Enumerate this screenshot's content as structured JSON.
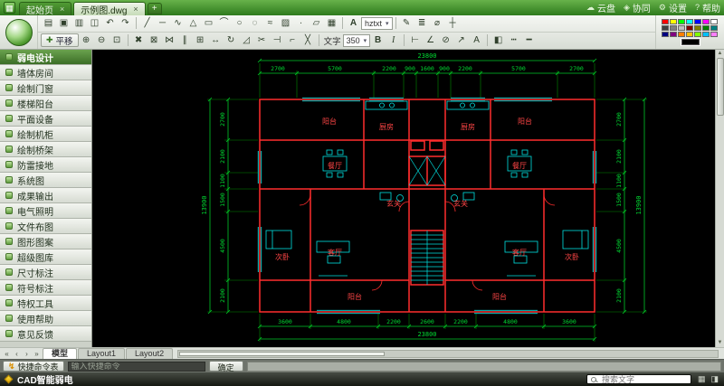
{
  "titlebar": {
    "app_icon_glyph": "▦",
    "close_glyph": "×",
    "new_tab_glyph": "+",
    "tabs": [
      {
        "name": "tab-start-page",
        "label": "起始页"
      },
      {
        "name": "tab-drawing",
        "label": "示例图.dwg"
      }
    ],
    "actions": [
      {
        "name": "cloud-drive-button",
        "icon": "☁",
        "label": "云盘"
      },
      {
        "name": "collaborate-button",
        "icon": "◈",
        "label": "协同"
      },
      {
        "name": "settings-button",
        "icon": "⚙",
        "label": "设置"
      },
      {
        "name": "help-button",
        "icon": "?",
        "label": "帮助"
      }
    ]
  },
  "toolbar": {
    "text_style_icon": "A",
    "text_style": "hztxt",
    "caret": "▾",
    "pan": {
      "label": "平移",
      "icon": "✚"
    },
    "text_label": "文字",
    "font_size": "350",
    "bold_label": "B",
    "italic_label": "I",
    "row1_file": [
      {
        "name": "open-file-icon",
        "g": "▤"
      },
      {
        "name": "save-icon",
        "g": "▣"
      },
      {
        "name": "save-as-icon",
        "g": "▥"
      },
      {
        "name": "print-icon",
        "g": "◫"
      },
      {
        "name": "undo-icon",
        "g": "↶"
      },
      {
        "name": "redo-icon",
        "g": "↷"
      }
    ],
    "row1_draw": [
      {
        "name": "line-icon",
        "g": "╱"
      },
      {
        "name": "construction-line-icon",
        "g": "─"
      },
      {
        "name": "polyline-icon",
        "g": "∿"
      },
      {
        "name": "polygon-icon",
        "g": "△"
      },
      {
        "name": "rectangle-icon",
        "g": "▭"
      },
      {
        "name": "arc-icon",
        "g": "⌒"
      },
      {
        "name": "circle-icon",
        "g": "○"
      },
      {
        "name": "revision-cloud-icon",
        "g": "◌"
      },
      {
        "name": "spline-icon",
        "g": "≈"
      },
      {
        "name": "hatch-icon",
        "g": "▨"
      },
      {
        "name": "point-icon",
        "g": "∙"
      },
      {
        "name": "block-icon",
        "g": "▱"
      },
      {
        "name": "table-icon",
        "g": "▦"
      }
    ],
    "row1_right": [
      {
        "name": "match-properties-icon",
        "g": "✎"
      },
      {
        "name": "layer-manager-icon",
        "g": "≣"
      },
      {
        "name": "measure-icon",
        "g": "⌀"
      },
      {
        "name": "osnap-icon",
        "g": "┼"
      }
    ],
    "row2_view": [
      {
        "name": "zoom-in-icon",
        "g": "⊕"
      },
      {
        "name": "zoom-out-icon",
        "g": "⊖"
      },
      {
        "name": "zoom-extents-icon",
        "g": "⊡"
      }
    ],
    "row2_mod": [
      {
        "name": "erase-icon",
        "g": "✖"
      },
      {
        "name": "copy-icon",
        "g": "⊠"
      },
      {
        "name": "mirror-icon",
        "g": "⋈"
      },
      {
        "name": "offset-icon",
        "g": "∥"
      },
      {
        "name": "array-icon",
        "g": "⊞"
      },
      {
        "name": "move-icon",
        "g": "↔"
      },
      {
        "name": "rotate-icon",
        "g": "↻"
      },
      {
        "name": "scale-icon",
        "g": "◿"
      },
      {
        "name": "trim-icon",
        "g": "✂"
      },
      {
        "name": "extend-icon",
        "g": "⊣"
      },
      {
        "name": "fillet-icon",
        "g": "⌐"
      },
      {
        "name": "explode-icon",
        "g": "╳"
      }
    ],
    "row2_dim": [
      {
        "name": "linear-dimension-icon",
        "g": "⊢"
      },
      {
        "name": "angular-dimension-icon",
        "g": "∠"
      },
      {
        "name": "radius-dimension-icon",
        "g": "⊘"
      },
      {
        "name": "leader-icon",
        "g": "↗"
      },
      {
        "name": "mtext-icon",
        "g": "A"
      }
    ],
    "row2_right": [
      {
        "name": "color-control-icon",
        "g": "◧"
      },
      {
        "name": "linetype-icon",
        "g": "┅"
      },
      {
        "name": "lineweight-icon",
        "g": "━"
      }
    ],
    "palette": [
      {
        "name": "color-swatch",
        "color": "#ff0000"
      },
      {
        "name": "color-swatch",
        "color": "#ffff00"
      },
      {
        "name": "color-swatch",
        "color": "#00ff00"
      },
      {
        "name": "color-swatch",
        "color": "#00ffff"
      },
      {
        "name": "color-swatch",
        "color": "#0000ff"
      },
      {
        "name": "color-swatch",
        "color": "#ff00ff"
      },
      {
        "name": "color-swatch",
        "color": "#ffffff"
      },
      {
        "name": "color-swatch",
        "color": "#414141"
      },
      {
        "name": "color-swatch",
        "color": "#808080"
      },
      {
        "name": "color-swatch",
        "color": "#c0c0c0"
      },
      {
        "name": "color-swatch",
        "color": "#800000"
      },
      {
        "name": "color-swatch",
        "color": "#808000"
      },
      {
        "name": "color-swatch",
        "color": "#008000"
      },
      {
        "name": "color-swatch",
        "color": "#008080"
      },
      {
        "name": "color-swatch",
        "color": "#000080"
      },
      {
        "name": "color-swatch",
        "color": "#800080"
      },
      {
        "name": "color-swatch",
        "color": "#ff7f00"
      },
      {
        "name": "color-swatch",
        "color": "#ffbf00"
      },
      {
        "name": "color-swatch",
        "color": "#7fff00"
      },
      {
        "name": "color-swatch",
        "color": "#00bfff"
      },
      {
        "name": "color-swatch",
        "color": "#ff7fff"
      }
    ]
  },
  "sidebar": {
    "items": [
      "弱电设计",
      "墙体房间",
      "绘制门窗",
      "楼梯阳台",
      "平面设备",
      "绘制机柜",
      "绘制桥架",
      "防雷接地",
      "系统图",
      "成果输出",
      "电气照明",
      "文件布图",
      "图形图案",
      "超级图库",
      "尺寸标注",
      "符号标注",
      "特权工具",
      "使用帮助",
      "意见反馈"
    ]
  },
  "canvas": {
    "dims_top": [
      "2700",
      "5700",
      "2200",
      "900",
      "1600",
      "900",
      "2200",
      "5700",
      "2700"
    ],
    "top_total": "23800",
    "dims_bottom": [
      "3600",
      "4800",
      "2200",
      "2600",
      "2200",
      "4800",
      "3600"
    ],
    "bottom_total": "23800",
    "dims_left": [
      "2700",
      "2100",
      "1100",
      "1500",
      "4500",
      "2100"
    ],
    "left_total": "13900",
    "dims_right": [
      "2700",
      "2100",
      "1100",
      "1500",
      "4500",
      "2100"
    ],
    "right_total": "13900",
    "rooms": {
      "balcony": "阳台",
      "kitchen": "厨房",
      "dining": "餐厅",
      "entry": "玄关",
      "living": "客厅",
      "bedroom": "次卧"
    }
  },
  "layoutbar": {
    "nav": [
      "«",
      "‹",
      "›",
      "»"
    ],
    "tabs": [
      "模型",
      "Layout1",
      "Layout2"
    ]
  },
  "commandbar": {
    "quick_icon": "↯",
    "quick_label": "快捷命令表",
    "input_placeholder": "输入快捷命令",
    "ok_label": "确定"
  },
  "statusbar": {
    "brand": "CAD智能弱电",
    "search_placeholder": "搜索文字",
    "icons": [
      {
        "name": "grid-status-icon",
        "g": "▦"
      },
      {
        "name": "panel-status-icon",
        "g": "◨"
      }
    ]
  }
}
